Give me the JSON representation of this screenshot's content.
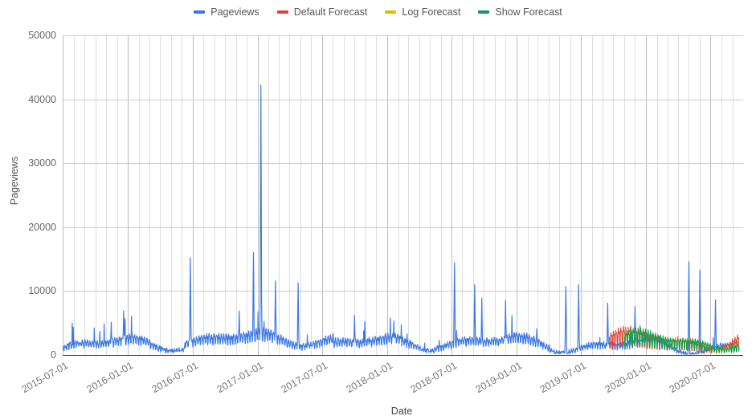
{
  "legend": {
    "position": "top",
    "items": [
      {
        "label": "Pageviews",
        "color": "#3b78e7",
        "name": "legend-item-pageviews"
      },
      {
        "label": "Default Forecast",
        "color": "#db4437",
        "name": "legend-item-default-forecast"
      },
      {
        "label": "Log Forecast",
        "color": "#f4b400",
        "name": "legend-item-log-forecast"
      },
      {
        "label": "Show Forecast",
        "color": "#0f9d58",
        "name": "legend-item-show-forecast"
      }
    ]
  },
  "chart_data": {
    "type": "line",
    "title": "",
    "xlabel": "Date",
    "ylabel": "Pageviews",
    "ylim": [
      0,
      50000
    ],
    "ytick_labels": [
      "0",
      "10000",
      "20000",
      "30000",
      "40000",
      "50000"
    ],
    "ytick_values": [
      0,
      10000,
      20000,
      30000,
      40000,
      50000
    ],
    "xlim": [
      "2015-07-01",
      "2020-10-01"
    ],
    "xtick_labels": [
      "2015-07-01",
      "2016-01-01",
      "2016-07-01",
      "2017-01-01",
      "2017-07-01",
      "2018-01-01",
      "2018-07-01",
      "2019-01-01",
      "2019-07-01",
      "2020-01-01",
      "2020-07-01"
    ],
    "grid": {
      "vertical": true,
      "horizontal": true,
      "minor_vertical": "monthly"
    },
    "legend_position": "top",
    "series": [
      {
        "name": "Pageviews",
        "color": "#3b78e7",
        "start": "2015-07-01",
        "end": "2020-09-20",
        "baseline_range": [
          900,
          3000
        ],
        "notable_peaks": [
          {
            "date": "2015-11-15",
            "value": 5100
          },
          {
            "date": "2015-12-20",
            "value": 6900
          },
          {
            "date": "2016-06-25",
            "value": 15200
          },
          {
            "date": "2016-11-10",
            "value": 6900
          },
          {
            "date": "2016-12-20",
            "value": 16000
          },
          {
            "date": "2017-01-10",
            "value": 42200
          },
          {
            "date": "2017-02-20",
            "value": 11600
          },
          {
            "date": "2017-04-25",
            "value": 11300
          },
          {
            "date": "2017-10-01",
            "value": 6200
          },
          {
            "date": "2018-01-20",
            "value": 5300
          },
          {
            "date": "2018-07-10",
            "value": 14400
          },
          {
            "date": "2018-09-05",
            "value": 11000
          },
          {
            "date": "2018-09-25",
            "value": 8900
          },
          {
            "date": "2018-12-01",
            "value": 8500
          },
          {
            "date": "2019-05-20",
            "value": 10700
          },
          {
            "date": "2019-06-25",
            "value": 11000
          },
          {
            "date": "2019-09-15",
            "value": 8100
          },
          {
            "date": "2019-12-01",
            "value": 7600
          },
          {
            "date": "2020-05-01",
            "value": 14600
          },
          {
            "date": "2020-06-01",
            "value": 13300
          },
          {
            "date": "2020-07-15",
            "value": 8600
          }
        ]
      },
      {
        "name": "Default Forecast",
        "color": "#db4437",
        "start": "2019-09-20",
        "end": "2020-09-20",
        "range": [
          600,
          5200
        ]
      },
      {
        "name": "Log Forecast",
        "color": "#f4b400",
        "start": "2019-11-01",
        "end": "2020-09-20",
        "range": [
          900,
          4800
        ]
      },
      {
        "name": "Show Forecast",
        "color": "#0f9d58",
        "start": "2019-11-01",
        "end": "2020-09-20",
        "range": [
          900,
          4600
        ]
      }
    ]
  }
}
